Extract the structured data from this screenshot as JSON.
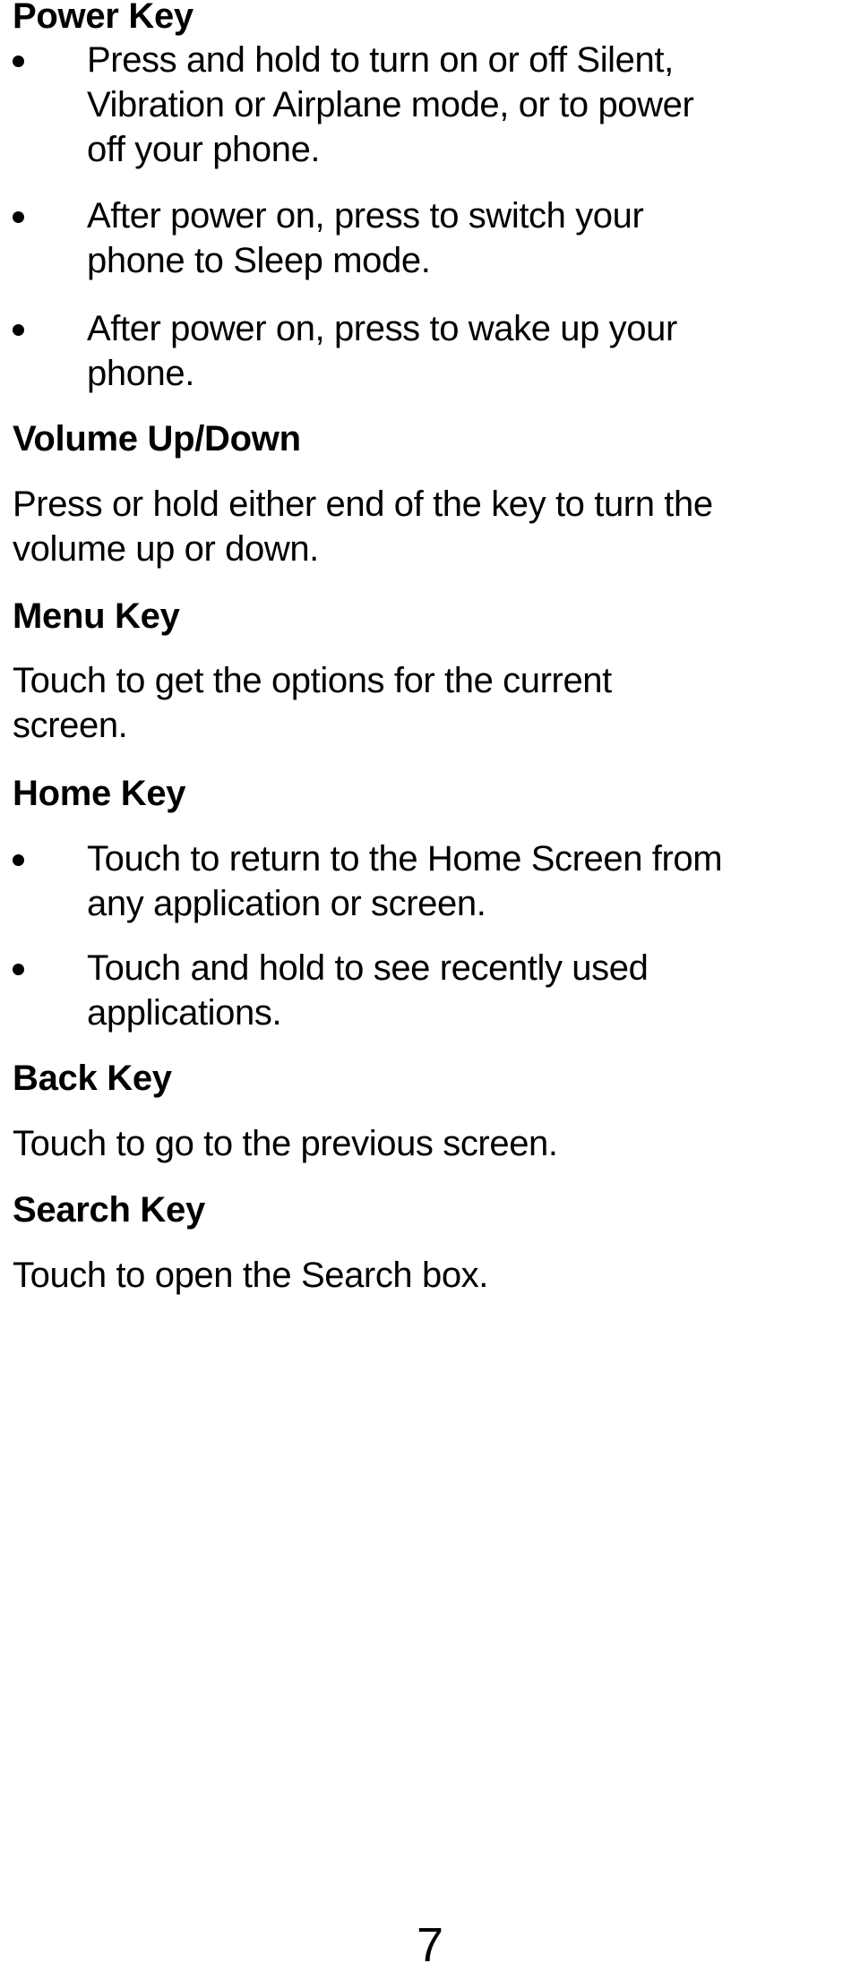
{
  "sections": {
    "power": {
      "heading": "Power Key",
      "bullets": [
        [
          "Press and hold to turn on or off Silent,",
          "Vibration or Airplane mode, or to power",
          "off your phone."
        ],
        [
          "After power on, press to switch your",
          "phone to Sleep mode."
        ],
        [
          "After power on, press to wake up your",
          "phone."
        ]
      ]
    },
    "volume": {
      "heading": "Volume Up/Down",
      "lines": [
        "Press or hold either end of the key to turn the",
        "volume up or down."
      ]
    },
    "menu": {
      "heading": "Menu Key",
      "lines": [
        "Touch to get the options for the current",
        "screen."
      ]
    },
    "home": {
      "heading": "Home Key",
      "bullets": [
        [
          "Touch to return to the Home Screen from",
          "any application or screen."
        ],
        [
          "Touch and hold to see recently used",
          "applications."
        ]
      ]
    },
    "back": {
      "heading": "Back Key",
      "lines": [
        "Touch to go to the previous screen."
      ]
    },
    "search": {
      "heading": "Search Key",
      "lines": [
        "Touch to open the Search box."
      ]
    }
  },
  "page_number": "7"
}
